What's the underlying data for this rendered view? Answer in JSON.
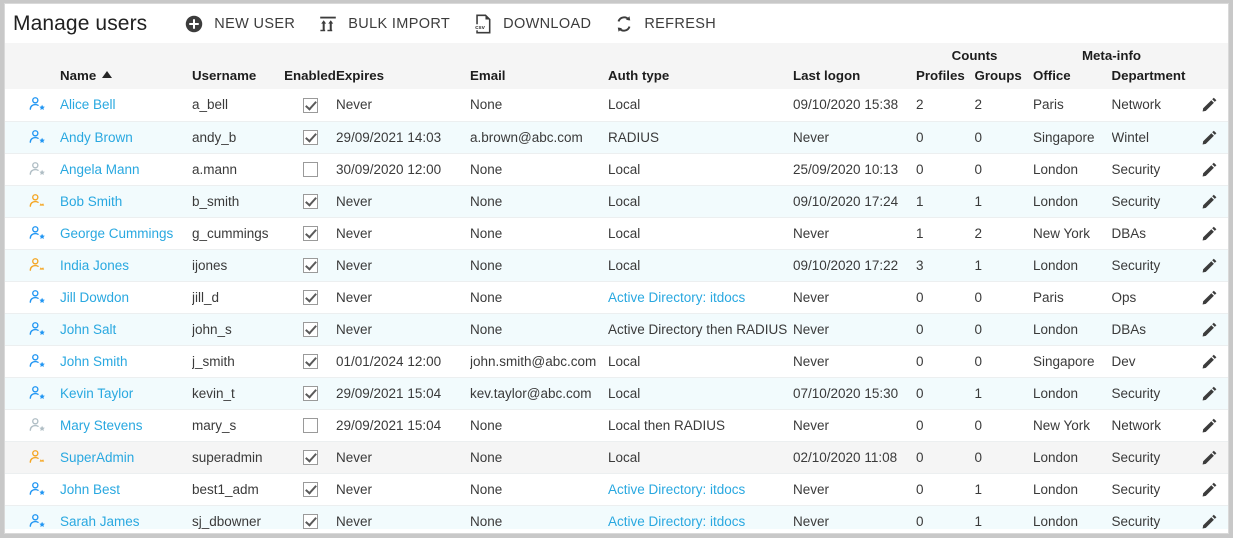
{
  "header": {
    "title": "Manage users",
    "buttons": [
      {
        "label": "NEW USER",
        "icon": "plus-circle-icon"
      },
      {
        "label": "BULK IMPORT",
        "icon": "bulk-import-icon"
      },
      {
        "label": "DOWNLOAD",
        "icon": "csv-file-icon"
      },
      {
        "label": "REFRESH",
        "icon": "refresh-icon"
      }
    ]
  },
  "table": {
    "group_headers": {
      "counts": "Counts",
      "meta_info": "Meta-info"
    },
    "columns": [
      {
        "key": "icon",
        "label": ""
      },
      {
        "key": "name",
        "label": "Name",
        "sorted": "asc"
      },
      {
        "key": "username",
        "label": "Username"
      },
      {
        "key": "enabled",
        "label": "Enabled"
      },
      {
        "key": "expires",
        "label": "Expires"
      },
      {
        "key": "email",
        "label": "Email"
      },
      {
        "key": "auth_type",
        "label": "Auth type"
      },
      {
        "key": "last_logon",
        "label": "Last logon"
      },
      {
        "key": "profiles",
        "label": "Profiles"
      },
      {
        "key": "groups",
        "label": "Groups"
      },
      {
        "key": "office",
        "label": "Office"
      },
      {
        "key": "department",
        "label": "Department"
      },
      {
        "key": "edit",
        "label": ""
      }
    ],
    "rows": [
      {
        "icon": "user-star-icon",
        "icon_color": "#2196f3",
        "name": "Alice Bell",
        "username": "a_bell",
        "enabled": true,
        "expires": "Never",
        "email": "None",
        "auth_type": "Local",
        "auth_link": false,
        "last_logon": "09/10/2020 15:38",
        "profiles": "2",
        "groups": "2",
        "office": "Paris",
        "department": "Network"
      },
      {
        "icon": "user-star-icon",
        "icon_color": "#2196f3",
        "name": "Andy Brown",
        "username": "andy_b",
        "enabled": true,
        "expires": "29/09/2021 14:03",
        "email": "a.brown@abc.com",
        "auth_type": "RADIUS",
        "auth_link": false,
        "last_logon": "Never",
        "profiles": "0",
        "groups": "0",
        "office": "Singapore",
        "department": "Wintel"
      },
      {
        "icon": "user-star-icon",
        "icon_color": "#b0bec5",
        "name": "Angela Mann",
        "username": "a.mann",
        "enabled": false,
        "expires": "30/09/2020 12:00",
        "email": "None",
        "auth_type": "Local",
        "auth_link": false,
        "last_logon": "25/09/2020 10:13",
        "profiles": "0",
        "groups": "0",
        "office": "London",
        "department": "Security"
      },
      {
        "icon": "user-admin-icon",
        "icon_color": "#f5a623",
        "name": "Bob Smith",
        "username": "b_smith",
        "enabled": true,
        "expires": "Never",
        "email": "None",
        "auth_type": "Local",
        "auth_link": false,
        "last_logon": "09/10/2020 17:24",
        "profiles": "1",
        "groups": "1",
        "office": "London",
        "department": "Security"
      },
      {
        "icon": "user-star-icon",
        "icon_color": "#2196f3",
        "name": "George Cummings",
        "username": "g_cummings",
        "enabled": true,
        "expires": "Never",
        "email": "None",
        "auth_type": "Local",
        "auth_link": false,
        "last_logon": "Never",
        "profiles": "1",
        "groups": "2",
        "office": "New York",
        "department": "DBAs"
      },
      {
        "icon": "user-admin-icon",
        "icon_color": "#f5a623",
        "name": "India Jones",
        "username": "ijones",
        "enabled": true,
        "expires": "Never",
        "email": "None",
        "auth_type": "Local",
        "auth_link": false,
        "last_logon": "09/10/2020 17:22",
        "profiles": "3",
        "groups": "1",
        "office": "London",
        "department": "Security"
      },
      {
        "icon": "user-star-icon",
        "icon_color": "#2196f3",
        "name": "Jill Dowdon",
        "username": "jill_d",
        "enabled": true,
        "expires": "Never",
        "email": "None",
        "auth_type": "Active Directory: itdocs",
        "auth_link": true,
        "last_logon": "Never",
        "profiles": "0",
        "groups": "0",
        "office": "Paris",
        "department": "Ops"
      },
      {
        "icon": "user-star-icon",
        "icon_color": "#2196f3",
        "name": "John Salt",
        "username": "john_s",
        "enabled": true,
        "expires": "Never",
        "email": "None",
        "auth_type": "Active Directory then RADIUS",
        "auth_link": false,
        "last_logon": "Never",
        "profiles": "0",
        "groups": "0",
        "office": "London",
        "department": "DBAs"
      },
      {
        "icon": "user-star-icon",
        "icon_color": "#2196f3",
        "name": "John Smith",
        "username": "j_smith",
        "enabled": true,
        "expires": "01/01/2024 12:00",
        "email": "john.smith@abc.com",
        "auth_type": "Local",
        "auth_link": false,
        "last_logon": "Never",
        "profiles": "0",
        "groups": "0",
        "office": "Singapore",
        "department": "Dev"
      },
      {
        "icon": "user-star-icon",
        "icon_color": "#2196f3",
        "name": "Kevin Taylor",
        "username": "kevin_t",
        "enabled": true,
        "expires": "29/09/2021 15:04",
        "email": "kev.taylor@abc.com",
        "auth_type": "Local",
        "auth_link": false,
        "last_logon": "07/10/2020 15:30",
        "profiles": "0",
        "groups": "1",
        "office": "London",
        "department": "Security"
      },
      {
        "icon": "user-star-icon",
        "icon_color": "#b0bec5",
        "name": "Mary Stevens",
        "username": "mary_s",
        "enabled": false,
        "expires": "29/09/2021 15:04",
        "email": "None",
        "auth_type": "Local then RADIUS",
        "auth_link": false,
        "last_logon": "Never",
        "profiles": "0",
        "groups": "0",
        "office": "New York",
        "department": "Network"
      },
      {
        "icon": "user-admin-icon",
        "icon_color": "#f5a623",
        "name": "SuperAdmin",
        "username": "superadmin",
        "enabled": true,
        "expires": "Never",
        "email": "None",
        "auth_type": "Local",
        "auth_link": false,
        "last_logon": "02/10/2020 11:08",
        "profiles": "0",
        "groups": "0",
        "office": "London",
        "department": "Security",
        "selected": true
      },
      {
        "icon": "user-star-icon",
        "icon_color": "#2196f3",
        "name": "John Best",
        "username": "best1_adm",
        "enabled": true,
        "expires": "Never",
        "email": "None",
        "auth_type": "Active Directory: itdocs",
        "auth_link": true,
        "last_logon": "Never",
        "profiles": "0",
        "groups": "1",
        "office": "London",
        "department": "Security"
      },
      {
        "icon": "user-star-icon",
        "icon_color": "#2196f3",
        "name": "Sarah James",
        "username": "sj_dbowner",
        "enabled": true,
        "expires": "Never",
        "email": "None",
        "auth_type": "Active Directory: itdocs",
        "auth_link": true,
        "last_logon": "Never",
        "profiles": "0",
        "groups": "1",
        "office": "London",
        "department": "Security"
      }
    ],
    "row_edit_icon": "pencil-icon"
  },
  "colors": {
    "link": "#29a8e0",
    "admin_icon": "#f5a623",
    "user_icon": "#2196f3",
    "disabled_icon": "#b0bec5",
    "header_bg": "#f5f5f5",
    "alt_row_bg": "#f2fbfd",
    "selected_row_bg": "#f5f5f5"
  }
}
